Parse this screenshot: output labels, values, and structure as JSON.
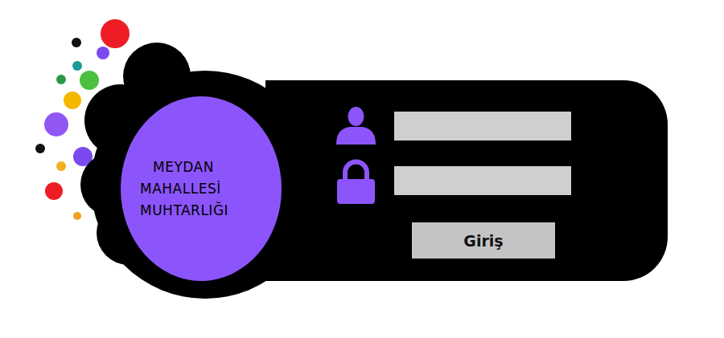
{
  "logo": {
    "lines": [
      "MEYDAN",
      "MAHALLESİ",
      "MUHTARLIĞI"
    ]
  },
  "form": {
    "fields": [
      {
        "kind": "user"
      },
      {
        "kind": "password"
      }
    ],
    "submit": "Giriş"
  }
}
